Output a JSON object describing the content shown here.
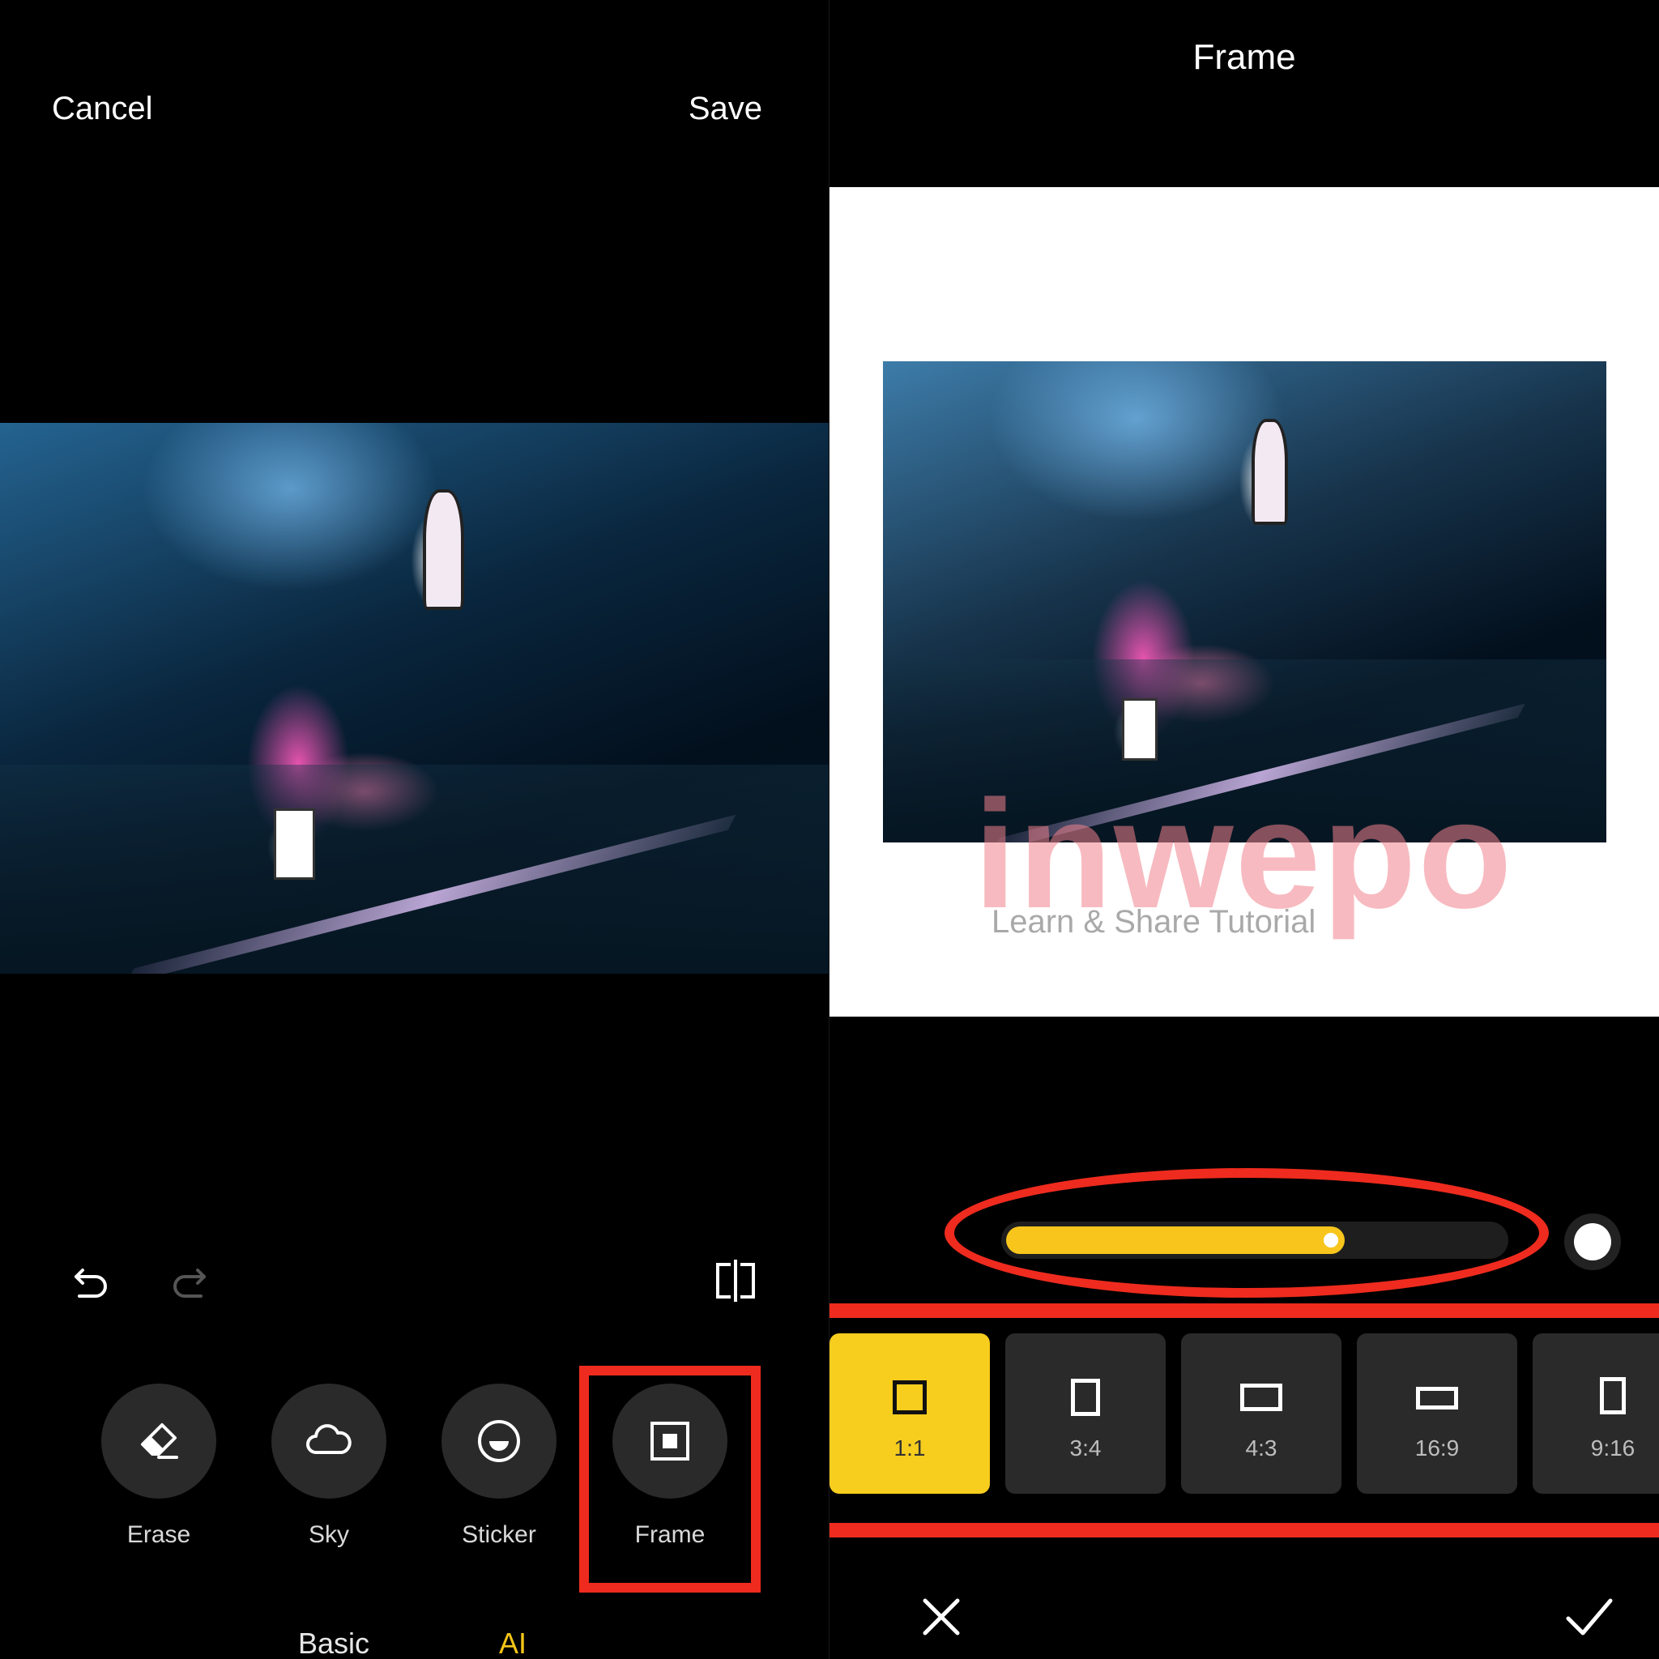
{
  "left": {
    "cancel_label": "Cancel",
    "save_label": "Save",
    "tools": [
      {
        "label": "Erase",
        "icon": "eraser-icon"
      },
      {
        "label": "Sky",
        "icon": "cloud-icon"
      },
      {
        "label": "Sticker",
        "icon": "sticker-icon"
      },
      {
        "label": "Frame",
        "icon": "frame-icon"
      }
    ],
    "tabs": {
      "basic": "Basic",
      "ai": "AI"
    },
    "highlight_color": "#ee2b1e"
  },
  "right": {
    "title": "Frame",
    "watermark": {
      "brand": "inwepo",
      "tagline": "Learn & Share Tutorial"
    },
    "slider": {
      "value": 0.68,
      "fill_color": "#f7c51c"
    },
    "swatch_color": "#ffffff",
    "ratios": [
      {
        "label": "1:1",
        "selected": true
      },
      {
        "label": "3:4",
        "selected": false
      },
      {
        "label": "4:3",
        "selected": false
      },
      {
        "label": "16:9",
        "selected": false
      },
      {
        "label": "9:16",
        "selected": false
      }
    ],
    "accent_color": "#f7cd1e"
  }
}
